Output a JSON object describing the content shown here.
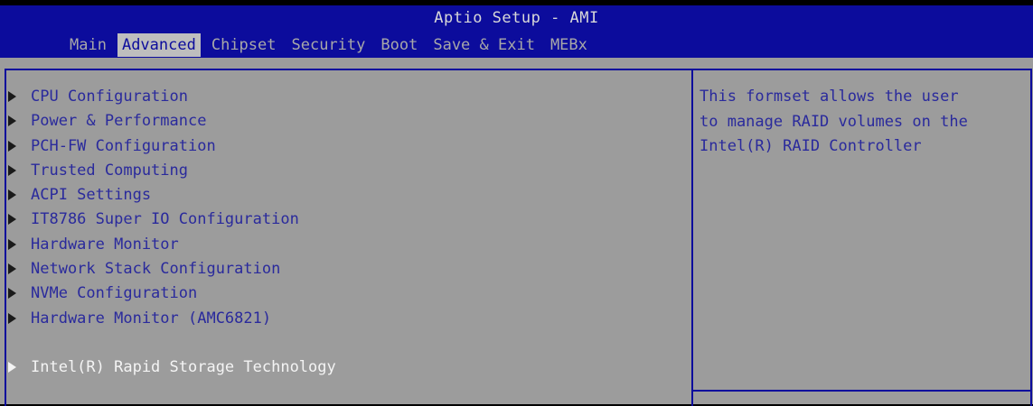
{
  "window": {
    "title": "Aptio Setup - AMI"
  },
  "tabs": [
    {
      "label": "Main",
      "active": false
    },
    {
      "label": "Advanced",
      "active": true
    },
    {
      "label": "Chipset",
      "active": false
    },
    {
      "label": "Security",
      "active": false
    },
    {
      "label": "Boot",
      "active": false
    },
    {
      "label": "Save & Exit",
      "active": false
    },
    {
      "label": "MEBx",
      "active": false
    }
  ],
  "menu": {
    "items": [
      {
        "label": "CPU Configuration"
      },
      {
        "label": "Power & Performance"
      },
      {
        "label": "PCH-FW Configuration"
      },
      {
        "label": "Trusted Computing"
      },
      {
        "label": "ACPI Settings"
      },
      {
        "label": "IT8786 Super IO Configuration"
      },
      {
        "label": "Hardware Monitor"
      },
      {
        "label": "Network Stack Configuration"
      },
      {
        "label": "NVMe Configuration"
      },
      {
        "label": "Hardware Monitor (AMC6821)"
      },
      {
        "label": "Intel(R) Rapid Storage Technology",
        "selected": true
      }
    ],
    "arrow_icon": "submenu-triangle-icon"
  },
  "help": {
    "lines": [
      "This formset allows the user",
      "to manage RAID volumes on the",
      "Intel(R) RAID Controller"
    ]
  },
  "colors": {
    "header_bg": "#0c0c9c",
    "body_bg": "#9c9c9c",
    "active_tab_bg": "#bebebe",
    "menu_text": "#2a2a9c",
    "selected_text": "#f4f4f4"
  }
}
